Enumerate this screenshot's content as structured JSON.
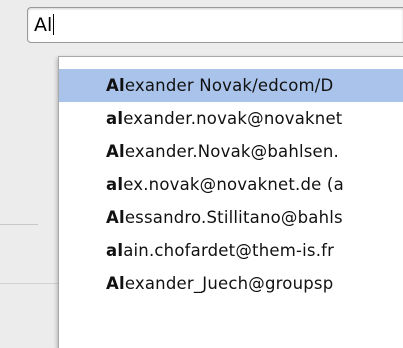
{
  "search": {
    "typed_text": "Al"
  },
  "suggestions": [
    {
      "match": "Al",
      "rest": "exander Novak/edcom/D",
      "selected": true
    },
    {
      "match": "al",
      "rest": "exander.novak@novaknet",
      "selected": false
    },
    {
      "match": "Al",
      "rest": "exander.Novak@bahlsen.",
      "selected": false
    },
    {
      "match": "al",
      "rest": "ex.novak@novaknet.de  (a",
      "selected": false
    },
    {
      "match": "Al",
      "rest": "essandro.Stillitano@bahls",
      "selected": false
    },
    {
      "match": "al",
      "rest": "ain.chofardet@them-is.fr",
      "selected": false
    },
    {
      "match": "Al",
      "rest": "exander_Juech@groupsp",
      "selected": false
    }
  ],
  "colors": {
    "selection": "#a9c3ea"
  }
}
